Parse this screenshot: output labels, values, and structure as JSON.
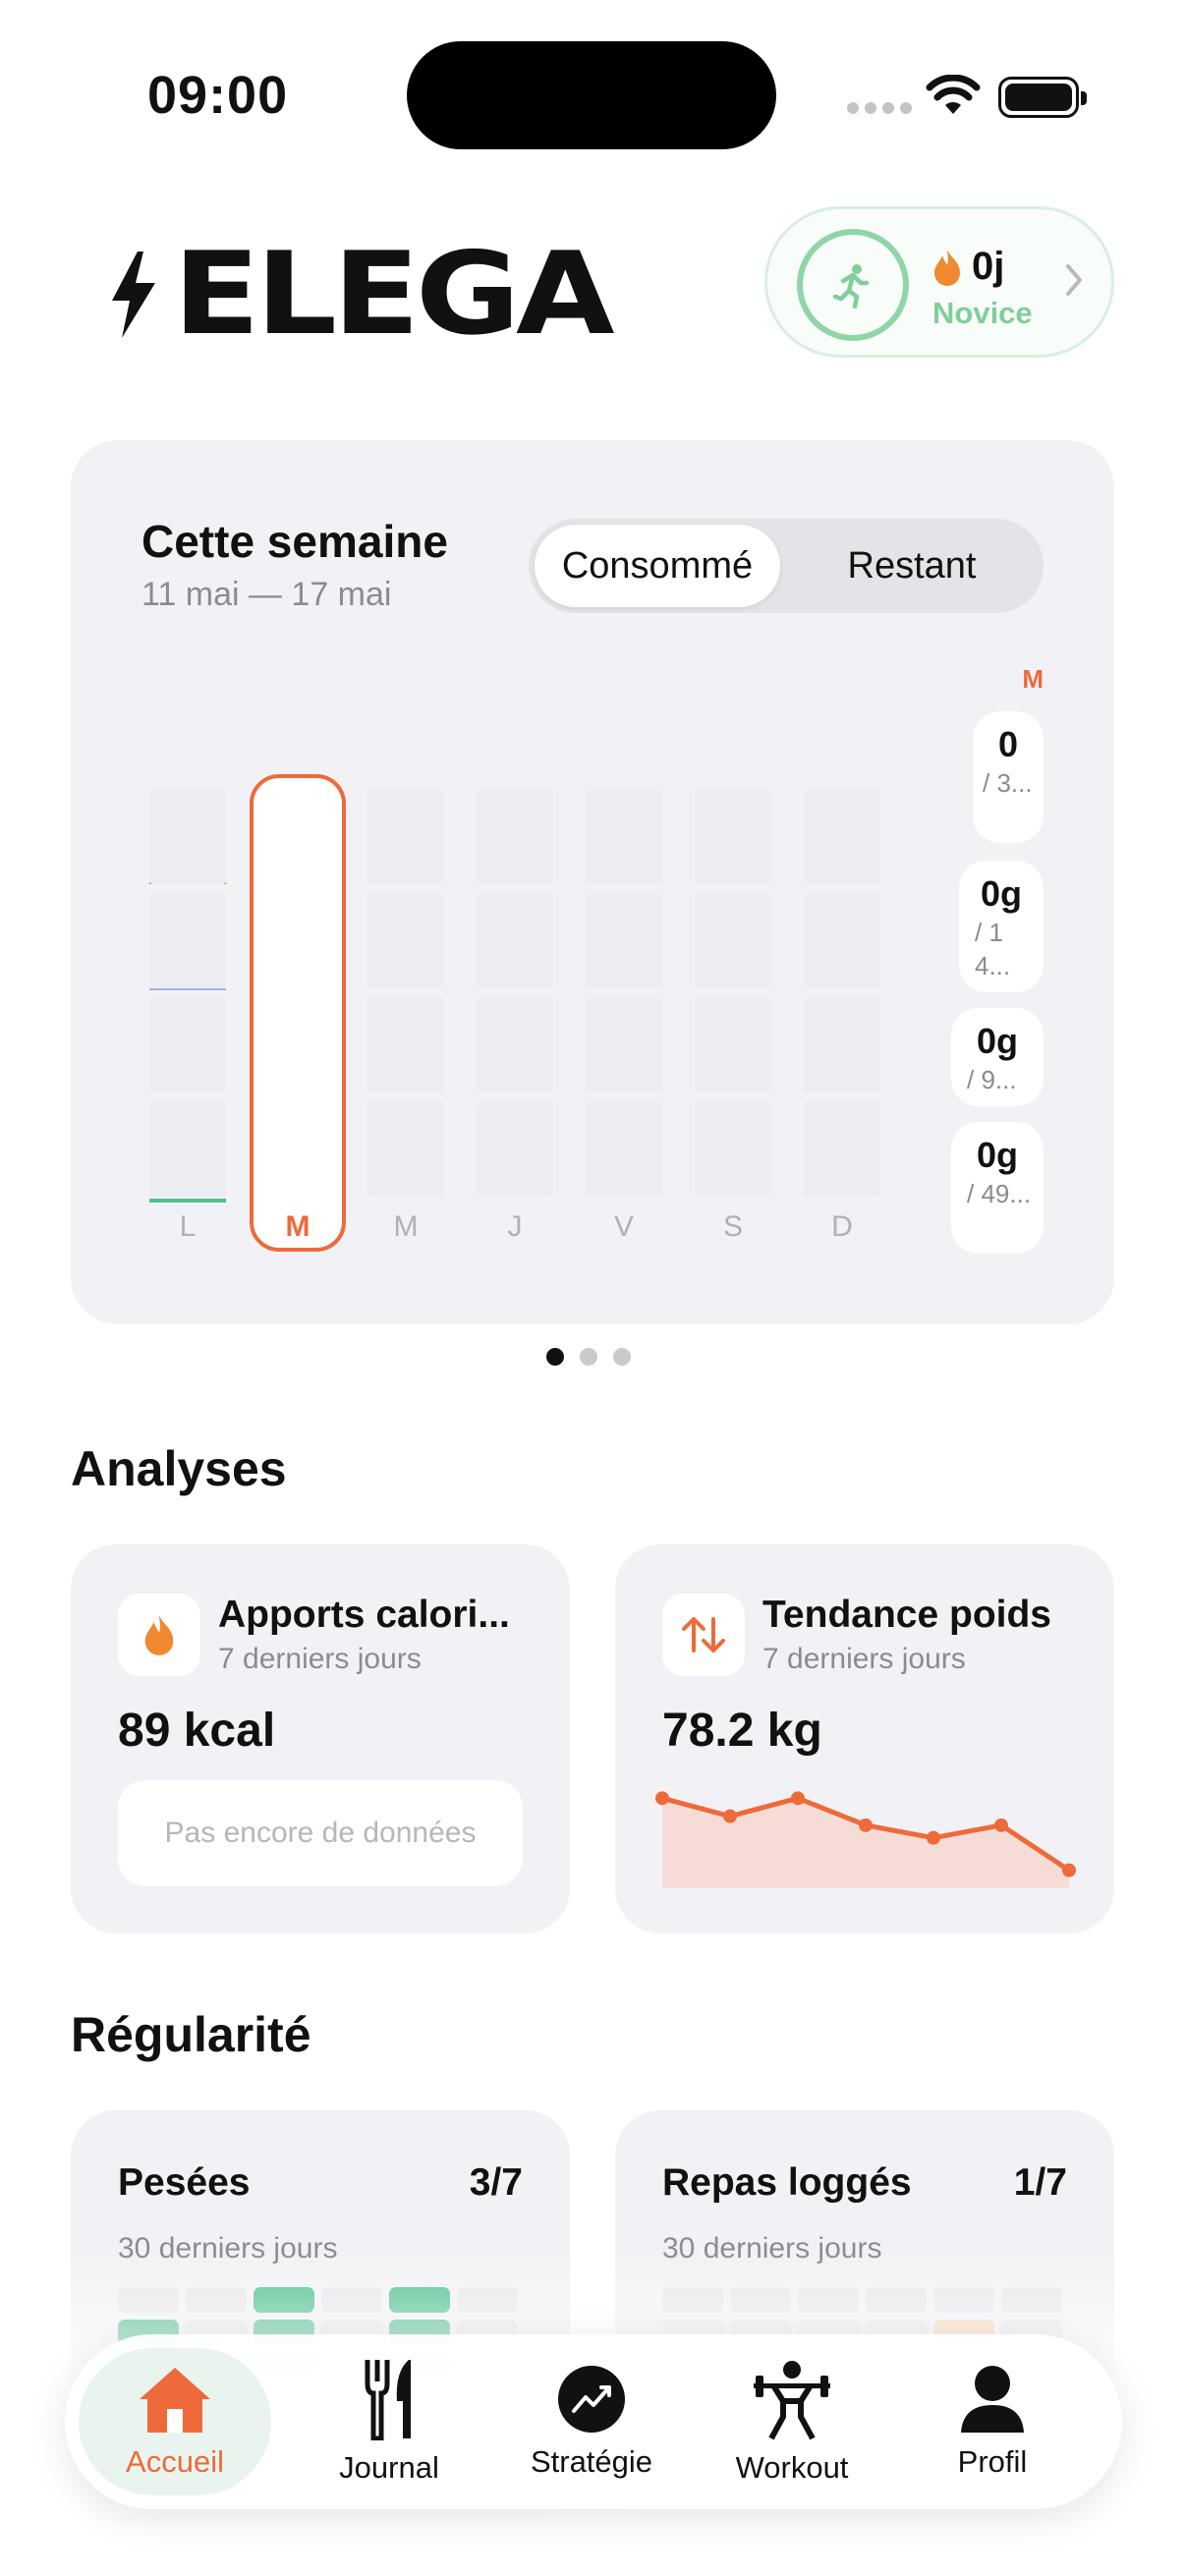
{
  "status_bar": {
    "time": "09:00"
  },
  "header": {
    "logo_text": "ELEGA",
    "streak": {
      "days": "0j",
      "level": "Novice"
    }
  },
  "week_card": {
    "title": "Cette semaine",
    "range": "11 mai — 17 mai",
    "segments": [
      "Consommé",
      "Restant"
    ],
    "selected_segment": "Consommé",
    "days": [
      "L",
      "M",
      "M",
      "J",
      "V",
      "S",
      "D"
    ],
    "active_day_index": 1,
    "macro_day_label": "M",
    "macros": [
      {
        "value": "0",
        "target": "/ 3..."
      },
      {
        "value": "0g",
        "target": "/ 14..."
      },
      {
        "value": "0g",
        "target": "/ 9..."
      },
      {
        "value": "0g",
        "target": "/ 49..."
      }
    ],
    "pager": {
      "count": 3,
      "current": 0
    }
  },
  "analyses": {
    "heading": "Analyses",
    "calories": {
      "title": "Apports calori...",
      "subtitle": "7 derniers jours",
      "value": "89 kcal",
      "empty": "Pas encore de données"
    },
    "weight": {
      "title": "Tendance poids",
      "subtitle": "7 derniers jours",
      "value": "78.2 kg"
    }
  },
  "chart_data": {
    "type": "area",
    "values": [
      78.6,
      78.5,
      78.6,
      78.45,
      78.38,
      78.45,
      78.2
    ],
    "ylim": [
      78.1,
      78.7
    ],
    "title": "",
    "xlabel": "",
    "ylabel": ""
  },
  "regularite": {
    "heading": "Régularité",
    "weighins": {
      "title": "Pesées",
      "count": "3/7",
      "subtitle": "30 derniers jours"
    },
    "meals": {
      "title": "Repas loggés",
      "count": "1/7",
      "subtitle": "30 derniers jours"
    }
  },
  "tabbar": {
    "items": [
      {
        "label": "Accueil",
        "icon": "home-icon"
      },
      {
        "label": "Journal",
        "icon": "fork-knife-icon"
      },
      {
        "label": "Stratégie",
        "icon": "chart-trend-icon"
      },
      {
        "label": "Workout",
        "icon": "weightlifter-icon"
      },
      {
        "label": "Profil",
        "icon": "person-icon"
      }
    ],
    "active": "Accueil"
  },
  "colors": {
    "accent": "#ee6a3a",
    "green": "#4fc08d",
    "card": "#f2f2f6"
  }
}
